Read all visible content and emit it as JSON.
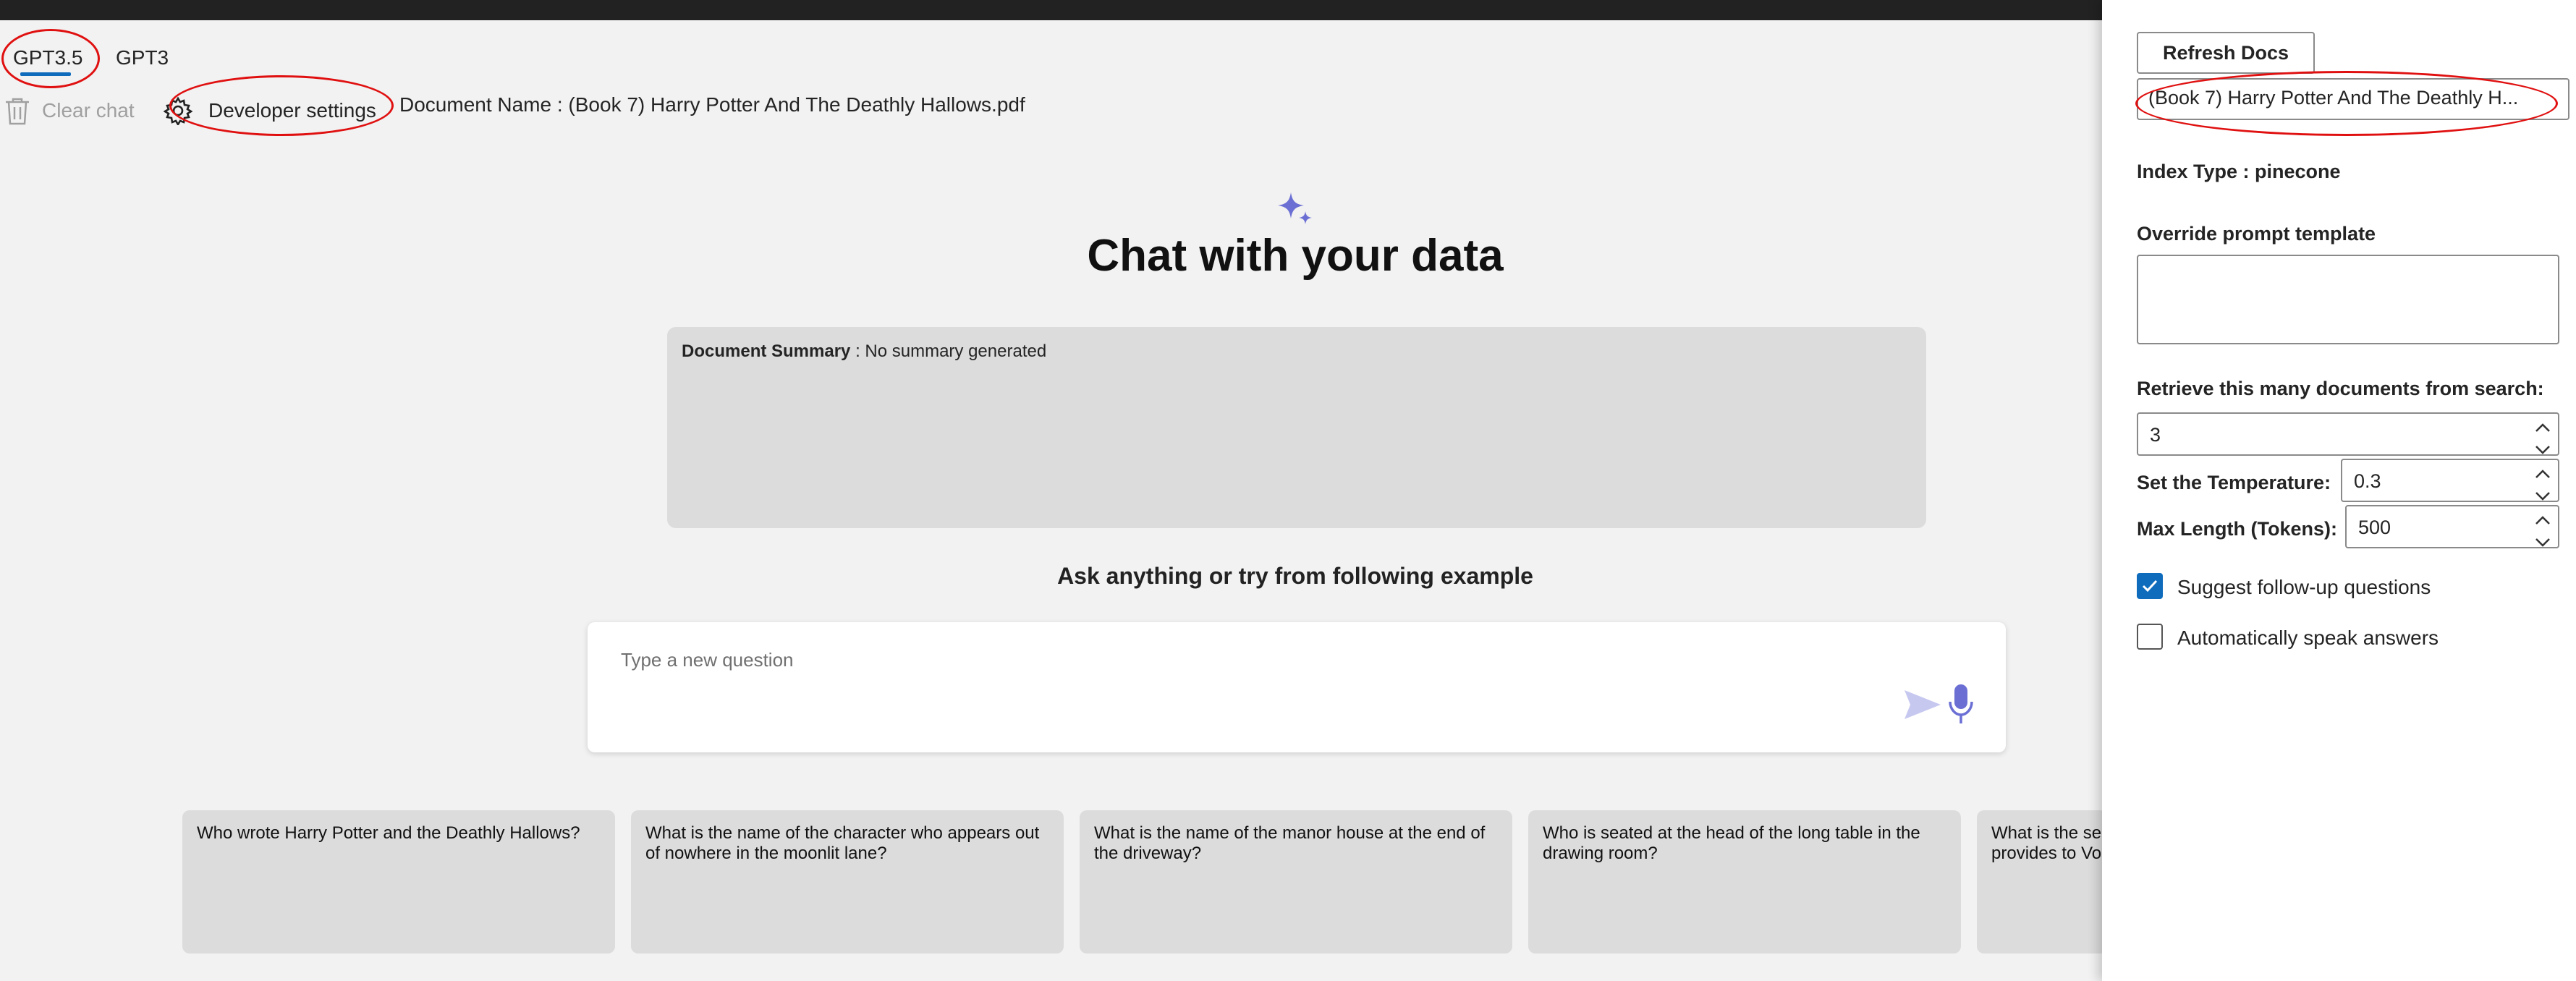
{
  "tabs": [
    {
      "label": "GPT3.5",
      "active": true
    },
    {
      "label": "GPT3",
      "active": false
    }
  ],
  "toolbar": {
    "clear_chat": "Clear chat",
    "developer_settings": "Developer settings",
    "document_name": "Document Name : (Book 7) Harry Potter And The Deathly Hallows.pdf"
  },
  "main": {
    "title": "Chat with your data",
    "summary_label": "Document Summary",
    "summary_text": ": No summary generated",
    "ask_text": "Ask anything or try from following example",
    "question_placeholder": "Type a new question",
    "examples": [
      "Who wrote Harry Potter and the Deathly Hallows?",
      "What is the name of the character who appears out of nowhere in the moonlit lane?",
      "What is the name of the manor house at the end of the driveway?",
      "Who is seated at the head of the long table in the drawing room?",
      "What is the se provides to Vo"
    ]
  },
  "panel": {
    "refresh_docs": "Refresh Docs",
    "selected_doc": "(Book 7) Harry Potter And The Deathly H...",
    "index_type": "Index Type : pinecone",
    "override_prompt_label": "Override prompt template",
    "override_prompt_value": "",
    "retrieve_label": "Retrieve this many documents from search:",
    "retrieve_value": "3",
    "temperature_label": "Set the Temperature:",
    "temperature_value": "0.3",
    "max_length_label": "Max Length (Tokens):",
    "max_length_value": "500",
    "suggest_followup_label": "Suggest follow-up questions",
    "suggest_followup_checked": true,
    "auto_speak_label": "Automatically speak answers",
    "auto_speak_checked": false
  },
  "colors": {
    "accent": "#0f6cbd",
    "annotation_red": "#e01010",
    "sparkle": "#6b6fd4",
    "send_icon": "#c7c8f0",
    "mic_icon": "#6b6fd4"
  }
}
